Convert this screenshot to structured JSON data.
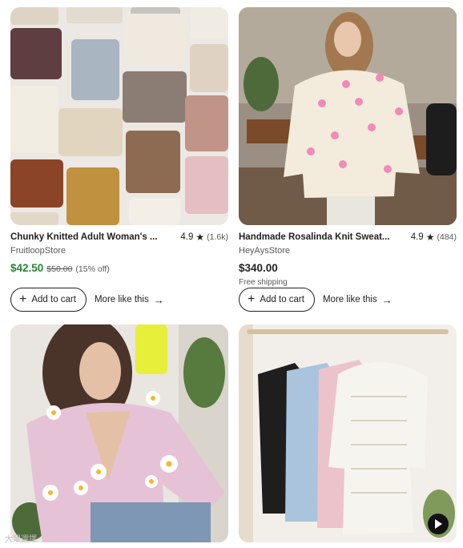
{
  "listings": [
    {
      "title": "Chunky Knitted Adult Woman's ...",
      "rating": "4.9",
      "reviews": "(1.6k)",
      "shop": "FruitloopStore",
      "price": "$42.50",
      "original_price": "$50.00",
      "discount": "(15% off)",
      "shipping": "",
      "add_to_cart": "Add to cart",
      "more_like_this": "More like this"
    },
    {
      "title": "Handmade Rosalinda Knit Sweat...",
      "rating": "4.9",
      "reviews": "(484)",
      "shop": "HeyAysStore",
      "price": "$340.00",
      "original_price": "",
      "discount": "",
      "shipping": "Free shipping",
      "add_to_cart": "Add to cart",
      "more_like_this": "More like this"
    }
  ],
  "watermark": "大眾選擇",
  "colors": {
    "sale_price": "#258635",
    "text": "#222222",
    "muted": "#595959"
  }
}
